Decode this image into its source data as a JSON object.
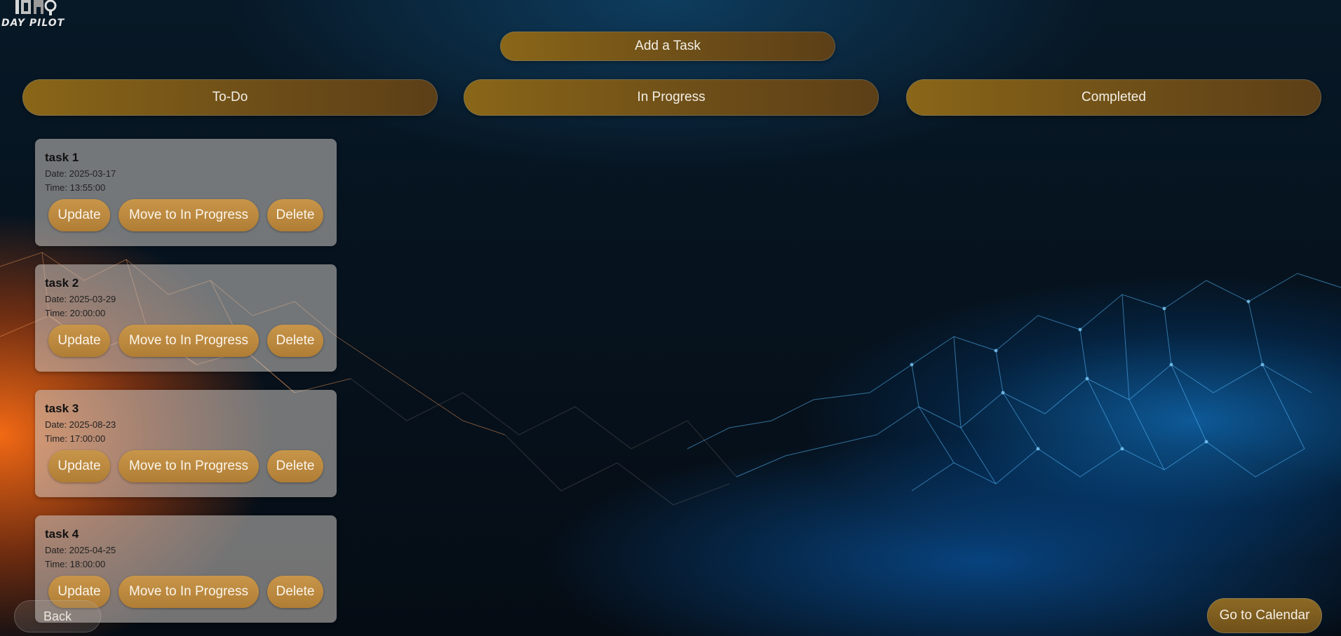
{
  "app": {
    "logo_text": "DAY PILOT",
    "add_task_label": "Add a Task"
  },
  "columns": {
    "todo": "To-Do",
    "in_progress": "In Progress",
    "completed": "Completed"
  },
  "tasks": [
    {
      "title": "task 1",
      "date": "Date: 2025-03-17",
      "time": "Time: 13:55:00"
    },
    {
      "title": "task 2",
      "date": "Date: 2025-03-29",
      "time": "Time: 20:00:00"
    },
    {
      "title": "task 3",
      "date": "Date: 2025-08-23",
      "time": "Time: 17:00:00"
    },
    {
      "title": "task 4",
      "date": "Date: 2025-04-25",
      "time": "Time: 18:00:00"
    }
  ],
  "task_actions": {
    "update": "Update",
    "move": "Move to In Progress",
    "delete": "Delete"
  },
  "footer": {
    "back_label": "Back",
    "calendar_label": "Go to Calendar"
  },
  "colors": {
    "accent_gold": "#8a6618",
    "button_gold": "#c8964a"
  }
}
